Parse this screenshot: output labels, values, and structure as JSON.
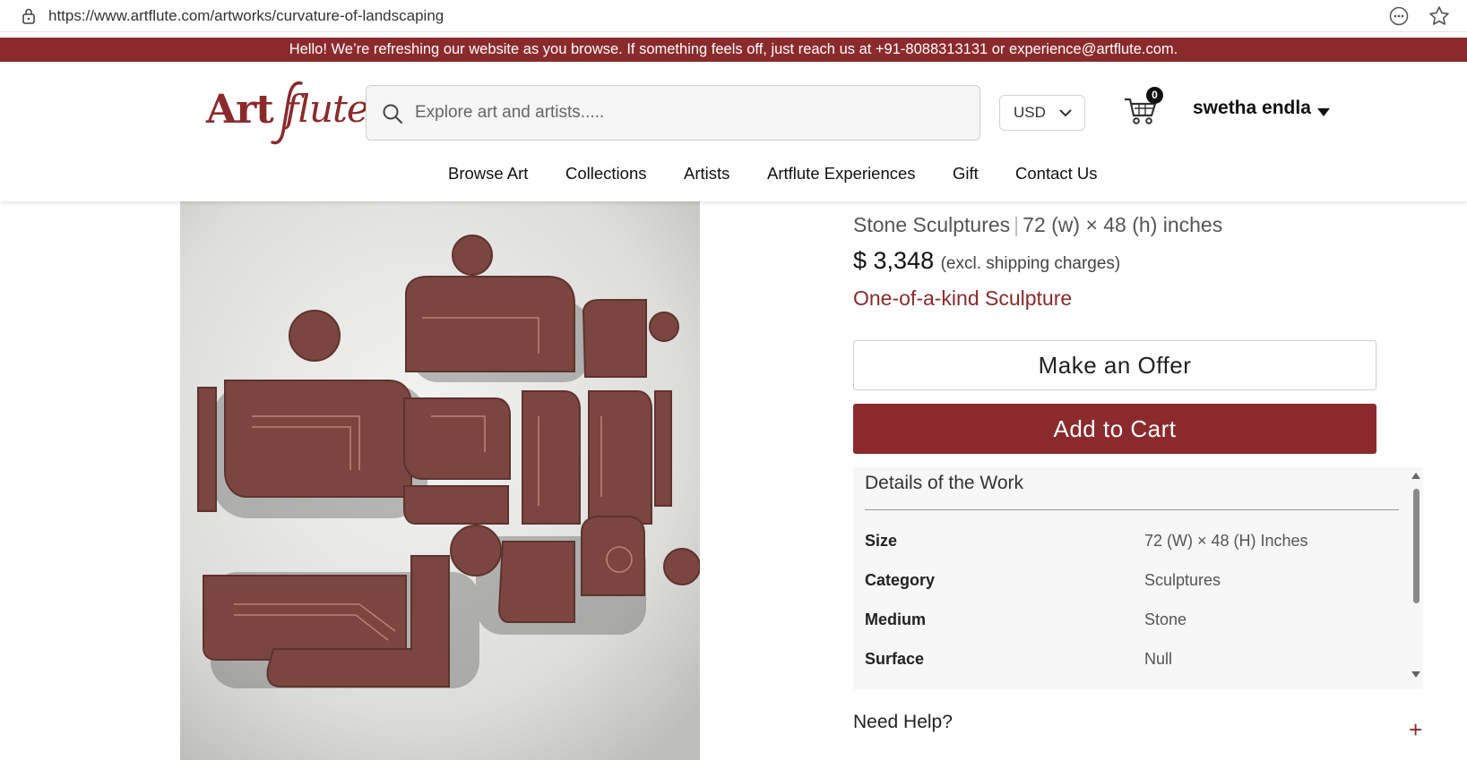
{
  "browser": {
    "url": "https://www.artflute.com/artworks/curvature-of-landscaping"
  },
  "banner": {
    "text": "Hello! We’re refreshing our website as you browse. If something feels off, just reach us at +91-8088313131 or experience@artflute.com."
  },
  "header": {
    "logo_text_bold": "Art",
    "logo_text_italic": "flute",
    "search_placeholder": "Explore art and artists.....",
    "currency": "USD",
    "cart_count": "0",
    "user_name": "swetha endla"
  },
  "nav": {
    "items": [
      "Browse Art",
      "Collections",
      "Artists",
      "Artflute Experiences",
      "Gift",
      "Contact Us"
    ]
  },
  "product": {
    "category_line": "Stone Sculptures",
    "separator": "|",
    "dimensions_line": "72 (w) × 48 (h) inches",
    "price": "$ 3,348",
    "price_note": "(excl. shipping charges)",
    "uniqueness": "One-of-a-kind Sculpture",
    "offer_label": "Make an Offer",
    "cart_label": "Add to Cart"
  },
  "details": {
    "title": "Details of the Work",
    "rows": [
      {
        "key": "Size",
        "value": "72 (W) × 48 (H) Inches"
      },
      {
        "key": "Category",
        "value": "Sculptures"
      },
      {
        "key": "Medium",
        "value": "Stone"
      },
      {
        "key": "Surface",
        "value": "Null"
      }
    ]
  },
  "help": {
    "label": "Need Help?",
    "expand_symbol": "+"
  },
  "colors": {
    "brand": "#8b2a2c",
    "sculpture": "#7a463f"
  }
}
